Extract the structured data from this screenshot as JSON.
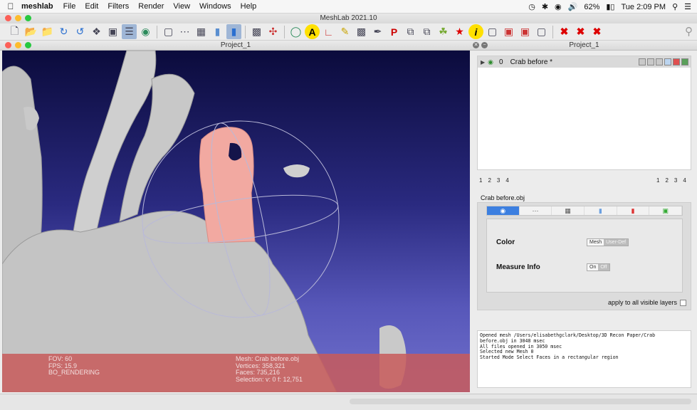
{
  "menubar": {
    "app": "meshlab",
    "items": [
      "File",
      "Edit",
      "Filters",
      "Render",
      "View",
      "Windows",
      "Help"
    ],
    "battery": "62%",
    "clock": "Tue 2:09 PM"
  },
  "window": {
    "title": "MeshLab 2021.10"
  },
  "toolbar": {
    "icons": [
      "new-icon",
      "open-icon",
      "open-project-icon",
      "reload-icon",
      "reload-all-icon",
      "save-icon",
      "snapshot-icon",
      "layers-icon",
      "bounding-box-icon",
      "points-icon",
      "wireframe-icon",
      "flat-icon",
      "smooth-icon",
      "textured-icon",
      "lighting-icon",
      "axis-icon",
      "trackball-icon",
      "annotation-icon",
      "measure-icon",
      "paint-icon",
      "pickpoints-icon",
      "align-icon",
      "geo-ref-icon",
      "info-icon",
      "select-faces-icon",
      "select-vertices-icon",
      "delete-faces-icon",
      "delete-vertices-icon",
      "close-x-icon",
      "close-x2-icon",
      "close-x3-icon"
    ]
  },
  "viewport": {
    "title": "Project_1",
    "hud": {
      "fov": "FOV: 60",
      "fps": "FPS:     15.9",
      "mode": "BO_RENDERING",
      "mesh": "Mesh: Crab before.obj",
      "vertices": "Vertices: 358,321",
      "faces": "Faces: 735,216",
      "selection": "Selection: v: 0 f: 12,751"
    }
  },
  "right_panel": {
    "title": "Project_1",
    "layer": {
      "index": "0",
      "name": "Crab before *"
    },
    "pager_left": [
      "1",
      "2",
      "3",
      "4"
    ],
    "pager_right": [
      "1",
      "2",
      "3",
      "4"
    ],
    "file": "Crab before.obj",
    "color_label": "Color",
    "color_options": [
      "Mesh",
      "User-Def"
    ],
    "measure_label": "Measure Info",
    "measure_options": [
      "On",
      "Off"
    ],
    "apply_all": "apply to all visible layers"
  },
  "log": [
    "Opened mesh /Users/elisabethgclark/Desktop/3D Recon Paper/Crab",
    "before.obj in 3048 msec",
    "All files opened in 3050 msec",
    "Selected new Mesh 0",
    "",
    "Started Mode Select Faces in a rectangular region"
  ]
}
